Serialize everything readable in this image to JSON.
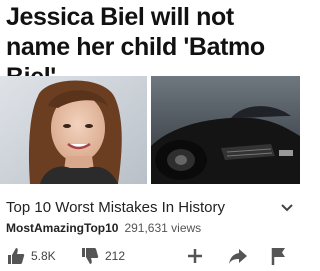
{
  "headline": "Jessica Biel will not name her child 'Batmo Biel'",
  "images": {
    "left": {
      "description_icon": "woman-portrait-photo"
    },
    "right": {
      "description_icon": "batmobile-photo"
    }
  },
  "video": {
    "title": "Top 10 Worst Mistakes In History",
    "channel": "MostAmazingTop10",
    "views": "291,631 views"
  },
  "actions": {
    "likes": "5.8K",
    "dislikes": "212",
    "add_icon": "plus-icon",
    "share_icon": "share-arrow-icon",
    "flag_icon": "flag-icon"
  },
  "colors": {
    "text": "#111111",
    "meta": "#555555",
    "icon": "#555555"
  }
}
